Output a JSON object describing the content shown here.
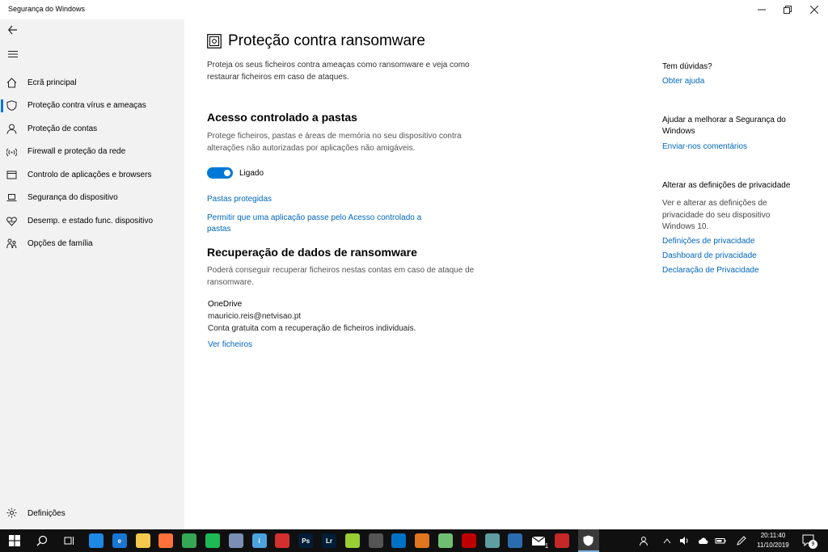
{
  "window": {
    "title": "Segurança do Windows"
  },
  "sidebar": {
    "items": [
      {
        "label": "Ecrã principal",
        "icon": "home-icon"
      },
      {
        "label": "Proteção contra vírus e ameaças",
        "icon": "shield-icon",
        "active": true
      },
      {
        "label": "Proteção de contas",
        "icon": "person-icon"
      },
      {
        "label": "Firewall e proteção da rede",
        "icon": "wifi-icon"
      },
      {
        "label": "Controlo de aplicações e browsers",
        "icon": "app-window-icon"
      },
      {
        "label": "Segurança do dispositivo",
        "icon": "laptop-icon"
      },
      {
        "label": "Desemp. e estado func. dispositivo",
        "icon": "heart-icon"
      },
      {
        "label": "Opções de família",
        "icon": "family-icon"
      }
    ],
    "settings_label": "Definições"
  },
  "main": {
    "title": "Proteção contra ransomware",
    "description": "Proteja os seus ficheiros contra ameaças como ransomware e veja como restaurar ficheiros em caso de ataques.",
    "cfa": {
      "title": "Acesso controlado a pastas",
      "description": "Protege ficheiros, pastas e áreas de memória no seu dispositivo contra alterações não autorizadas por aplicações não amigáveis.",
      "toggle_state": true,
      "toggle_label": "Ligado",
      "link_protected_folders": "Pastas protegidas",
      "link_allow_app": "Permitir que uma aplicação passe pelo Acesso controlado a pastas"
    },
    "recovery": {
      "title": "Recuperação de dados de ransomware",
      "description": "Poderá conseguir recuperar ficheiros nestas contas em caso de ataque de ransomware.",
      "provider": "OneDrive",
      "account": "mauricio.reis@netvisao.pt",
      "plan": "Conta gratuita com a recuperação de ficheiros individuais.",
      "link_view_files": "Ver ficheiros"
    }
  },
  "aside": {
    "questions_title": "Tem dúvidas?",
    "get_help": "Obter ajuda",
    "improve_title": "Ajudar a melhorar a Segurança do Windows",
    "feedback": "Enviar-nos comentários",
    "privacy_title": "Alterar as definições de privacidade",
    "privacy_text": "Ver e alterar as definições de privacidade do seu dispositivo Windows 10.",
    "privacy_links": [
      "Definições de privacidade",
      "Dashboard de privacidade",
      "Declaração de Privacidade"
    ]
  },
  "taskbar": {
    "time": "20:11:40",
    "date": "11/10/2019",
    "notification_count": "9",
    "mail_badge": "1",
    "apps": [
      {
        "name": "thunderbird",
        "color": "#1e88e5",
        "glyph": ""
      },
      {
        "name": "edge",
        "color": "#1976d2",
        "glyph": "e"
      },
      {
        "name": "explorer",
        "color": "#f2c94c",
        "glyph": ""
      },
      {
        "name": "firefox",
        "color": "#ff7139",
        "glyph": ""
      },
      {
        "name": "chrome",
        "color": "#34a853",
        "glyph": ""
      },
      {
        "name": "spotify",
        "color": "#1db954",
        "glyph": ""
      },
      {
        "name": "app-globe",
        "color": "#7b8fb4",
        "glyph": ""
      },
      {
        "name": "app-i",
        "color": "#4aa3df",
        "glyph": "i"
      },
      {
        "name": "app-red",
        "color": "#d32f2f",
        "glyph": ""
      },
      {
        "name": "photoshop",
        "color": "#001e36",
        "glyph": "Ps"
      },
      {
        "name": "lightroom",
        "color": "#001e36",
        "glyph": "Lr"
      },
      {
        "name": "app-yellow",
        "color": "#9acd32",
        "glyph": ""
      },
      {
        "name": "app-x",
        "color": "#555555",
        "glyph": ""
      },
      {
        "name": "outlook",
        "color": "#0072c6",
        "glyph": ""
      },
      {
        "name": "app-orange",
        "color": "#e0761f",
        "glyph": ""
      },
      {
        "name": "app-green",
        "color": "#6fbf73",
        "glyph": ""
      },
      {
        "name": "filezilla",
        "color": "#bf0000",
        "glyph": ""
      },
      {
        "name": "onedrive",
        "color": "#5f9ea0",
        "glyph": ""
      },
      {
        "name": "app-blue",
        "color": "#2b6cb0",
        "glyph": ""
      },
      {
        "name": "mail",
        "color": "#ffffff",
        "glyph": ""
      },
      {
        "name": "app-biohazard",
        "color": "#c62828",
        "glyph": ""
      },
      {
        "name": "windows-security",
        "color": "#3a3a3a",
        "glyph": ""
      }
    ]
  },
  "colors": {
    "accent": "#0078d7",
    "link": "#0067c0",
    "sidebar_bg": "#f2f2f2",
    "taskbar_bg": "#101010"
  }
}
